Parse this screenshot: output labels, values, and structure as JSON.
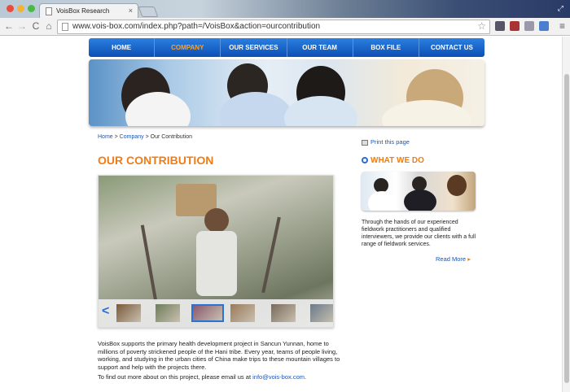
{
  "browser": {
    "tab_title": "VoisBox Research",
    "tab_close": "×",
    "url": "www.vois-box.com/index.php?path=/VoisBox&action=ourcontribution",
    "back_glyph": "←",
    "forward_glyph": "→",
    "reload_glyph": "C",
    "home_glyph": "⌂",
    "star_glyph": "☆",
    "menu_glyph": "≡",
    "resize_glyph": "⤢"
  },
  "nav": {
    "items": [
      "HOME",
      "COMPANY",
      "OUR SERVICES",
      "OUR TEAM",
      "BOX FILE",
      "CONTACT US"
    ],
    "active_index": 1
  },
  "breadcrumb": {
    "home": "Home",
    "sep1": " > ",
    "company": "Company",
    "sep2": " > ",
    "current": "Our Contribution"
  },
  "page": {
    "title": "OUR CONTRIBUTION",
    "body": "VoisBox supports the primary health development project in Sancun Yunnan, home to millions of poverty strickened people of the Hani tribe. Every year, teams of people living, working, and studying in the urban cities of China make trips to these mountain villages to support and help with the projects there.",
    "contact_prefix": "To find out more about on this project, please email us at ",
    "contact_email": "info@vois-box.com",
    "contact_suffix": "."
  },
  "gallery": {
    "prev_glyph": "<",
    "next_glyph": ">",
    "selected_thumb": 2,
    "thumb_colors": [
      "#7a5a3a",
      "#6f7d5a",
      "#8a5a70",
      "#9a7a5a",
      "#7a6a5a",
      "#6a7a8a",
      "#8a7a4a"
    ]
  },
  "sidebar": {
    "print_label": "Print this page",
    "what_we_do_title": "WHAT WE DO",
    "what_we_do_text": "Through the hands of our experienced fieldwork practitioners and qualified interviewers, we provide our clients with a full range of fieldwork services.",
    "read_more": "Read More",
    "read_more_arrow": "▸"
  },
  "colors": {
    "accent_orange": "#ef7d16",
    "link_blue": "#1a55b3",
    "nav_blue": "#0d4fb5"
  }
}
